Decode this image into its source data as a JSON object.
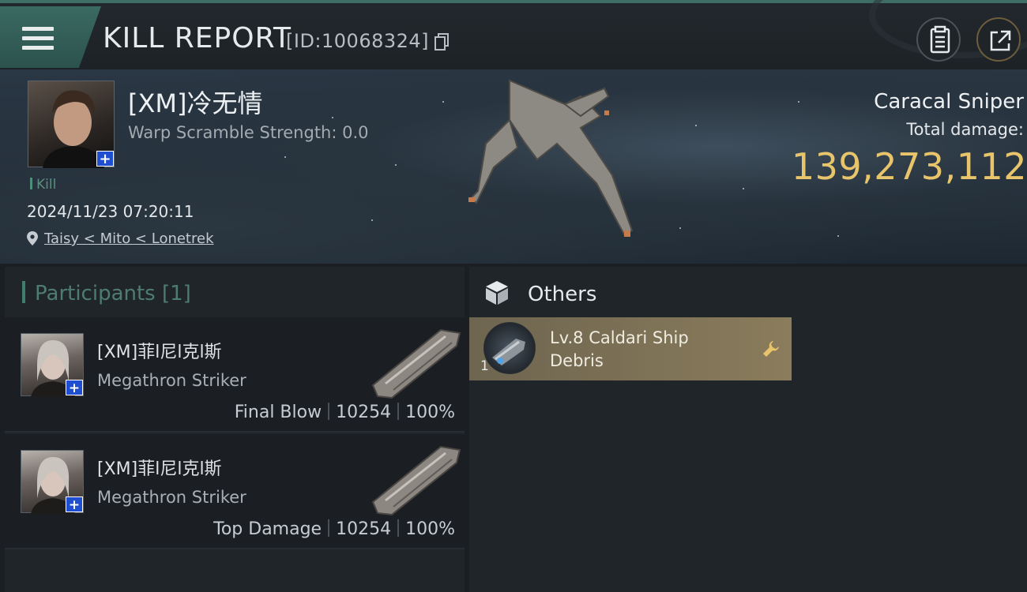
{
  "header": {
    "title": "KILL REPORT",
    "report_id": "[ID:10068324]"
  },
  "victim": {
    "name": "[XM]冷无情",
    "warp_scramble": "Warp Scramble Strength: 0.0",
    "kill_tag": "Kill",
    "datetime": "2024/11/23 07:20:11",
    "location": "Taisy < Mito < Lonetrek",
    "ship_name": "Caracal Sniper",
    "damage_label": "Total damage:",
    "damage_value": "139,273,112"
  },
  "participants": {
    "label": "Participants",
    "count": "[1]",
    "rows": [
      {
        "name": "[XM]菲l尼l克l斯",
        "ship": "Megathron Striker",
        "role": "Final Blow",
        "damage": "10254",
        "percent": "100%"
      },
      {
        "name": "[XM]菲l尼l克l斯",
        "ship": "Megathron Striker",
        "role": "Top Damage",
        "damage": "10254",
        "percent": "100%"
      }
    ]
  },
  "others": {
    "title": "Others",
    "items": [
      {
        "name": "Lv.8 Caldari Ship Debris",
        "quantity": "1"
      }
    ]
  },
  "colors": {
    "accent_teal": "#3f7d6d",
    "damage_gold": "#e8c46b",
    "item_card": "#8a7c5c",
    "badge_blue": "#1f4fd0"
  }
}
